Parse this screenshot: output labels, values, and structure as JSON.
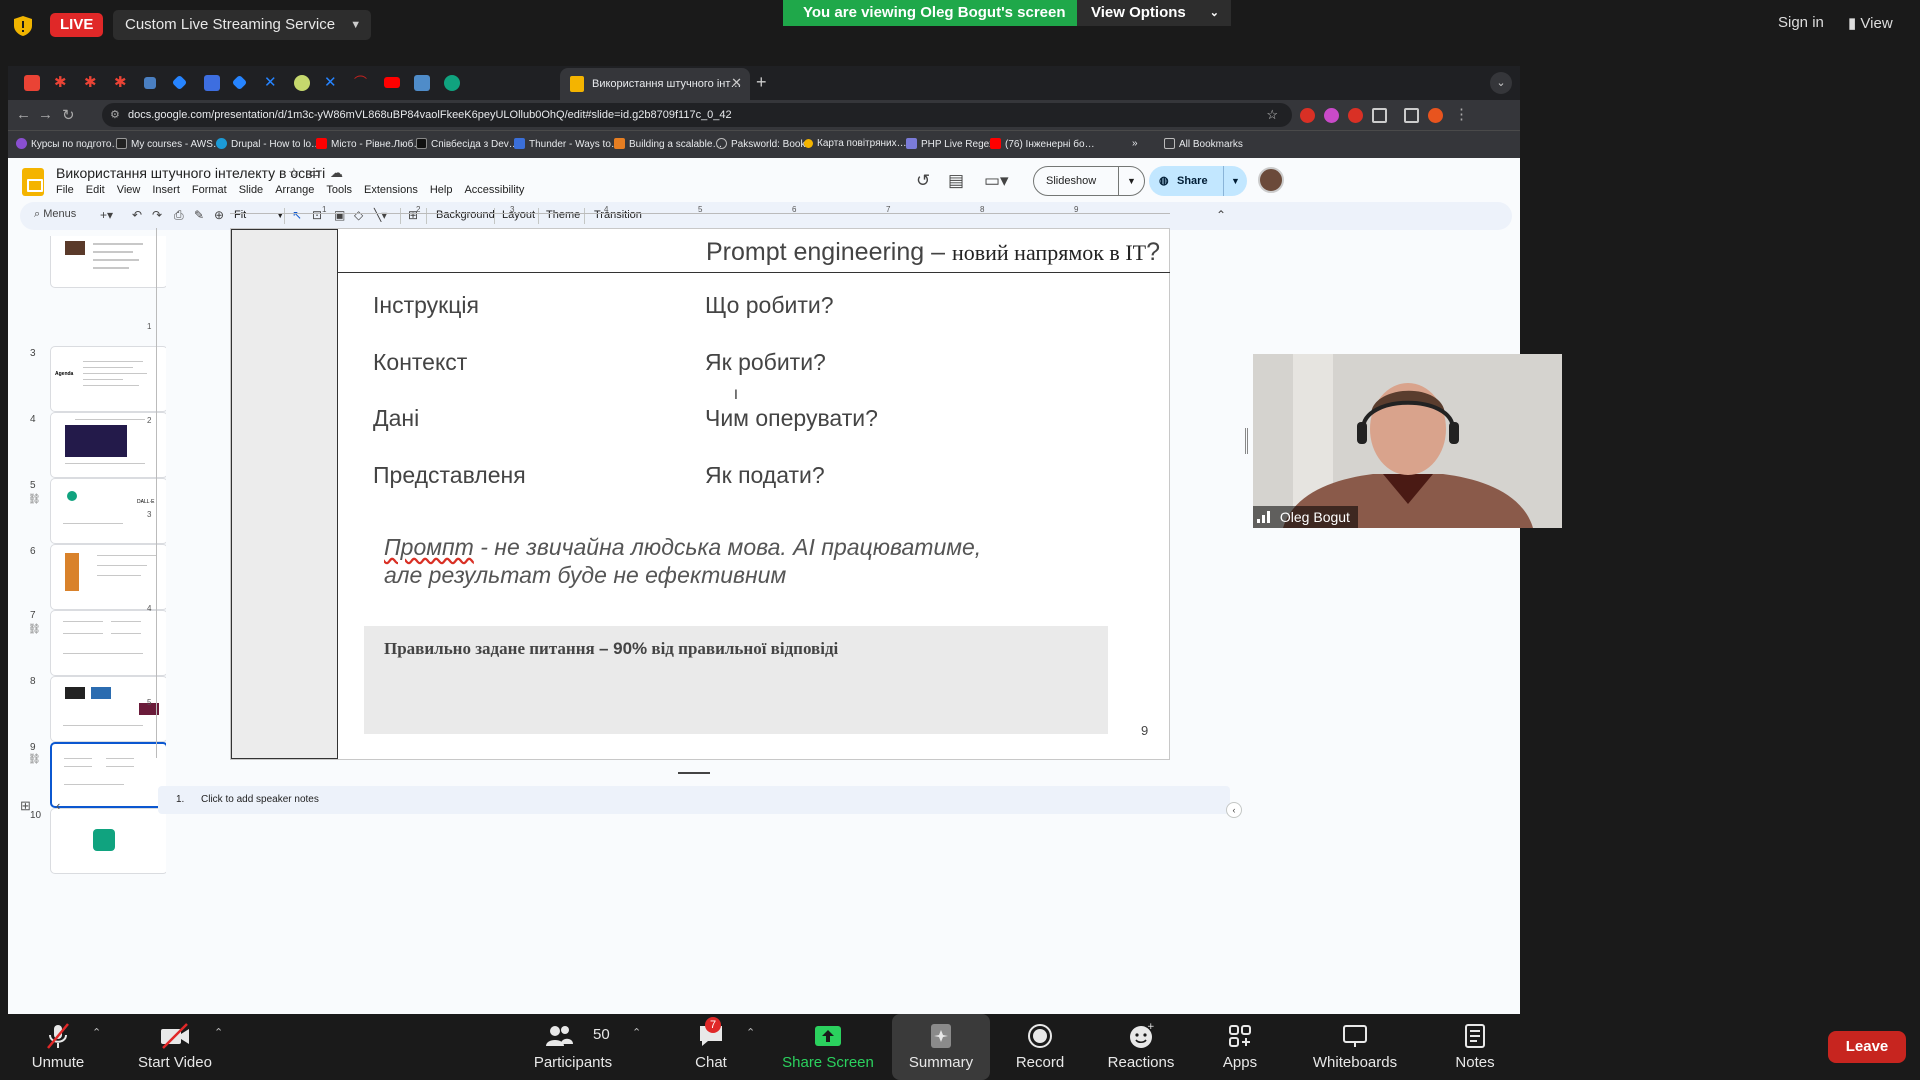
{
  "zoom_top": {
    "live_label": "LIVE",
    "stream_service": "Custom Live Streaming Service",
    "viewing_banner": "You are viewing Oleg Bogut's screen",
    "view_options": "View Options",
    "sign_in": "Sign in",
    "view": "View"
  },
  "browser": {
    "active_tab": "Використання штучного інт…",
    "url": "docs.google.com/presentation/d/1m3c-yW86mVL868uBP84vaolFkeeK6peyULOllub0OhQ/edit#slide=id.g2b8709f117c_0_42",
    "bookmarks": [
      "Курсы по подгото…",
      "My courses - AWS…",
      "Drupal - How to lo…",
      "Місто - Рівне.Люб…",
      "Співбесіда з Dev…",
      "Thunder - Ways to…",
      "Building a scalable…",
      "Paksworld: Books",
      "Карта повітряних…",
      "PHP Live Regex",
      "(76) Інженерні бо…"
    ],
    "all_bookmarks": "All Bookmarks"
  },
  "docs": {
    "title": "Використання штучного інтелекту в освіті",
    "menu": [
      "File",
      "Edit",
      "View",
      "Insert",
      "Format",
      "Slide",
      "Arrange",
      "Tools",
      "Extensions",
      "Help",
      "Accessibility"
    ],
    "slideshow": "Slideshow",
    "share": "Share",
    "toolbar": {
      "menus": "Menus",
      "zoom": "Fit",
      "background": "Background",
      "layout": "Layout",
      "theme": "Theme",
      "transition": "Transition"
    },
    "slide_numbers": [
      "3",
      "4",
      "5",
      "6",
      "7",
      "8",
      "9",
      "10"
    ],
    "ruler_numbers": [
      "1",
      "2",
      "3",
      "4",
      "5",
      "6",
      "7",
      "8",
      "9"
    ],
    "ruler_left": [
      "1",
      "2",
      "3",
      "4",
      "5"
    ],
    "notes_number": "1.",
    "notes_placeholder": "Click to add speaker notes"
  },
  "slide": {
    "title_main": "Prompt engineering",
    "title_dash": " – ",
    "title_serif": "новий напрямок в IT",
    "title_q": "?",
    "rows": [
      {
        "left": "Інструкція",
        "right": "Що робити?"
      },
      {
        "left": "Контекст",
        "right": "Як робити?"
      },
      {
        "left": "Дані",
        "right": "Чим оперувати?"
      },
      {
        "left": "Представленя",
        "right": "Як подати?"
      }
    ],
    "italic_word": "Промпт",
    "italic_line1": " - не звичайна людська мова. AI працюватиме,",
    "italic_line2": "але результат буде не ефективним",
    "box_text_a": "Правильно задане питання ",
    "box_text_b": "– 90%",
    "box_text_c": " від правильної відповіді",
    "page": "9"
  },
  "webcam": {
    "name": "Oleg Bogut"
  },
  "zoom_bottom": {
    "unmute": "Unmute",
    "start_video": "Start Video",
    "participants": "Participants",
    "participants_count": "50",
    "chat": "Chat",
    "chat_badge": "7",
    "share_screen": "Share Screen",
    "summary": "Summary",
    "record": "Record",
    "reactions": "Reactions",
    "apps": "Apps",
    "whiteboards": "Whiteboards",
    "notes": "Notes",
    "leave": "Leave"
  },
  "colors": {
    "live_red": "#e02828",
    "zoom_green": "#1fa84a",
    "docs_yellow": "#f4b400",
    "share_blue": "#c2e7ff"
  }
}
